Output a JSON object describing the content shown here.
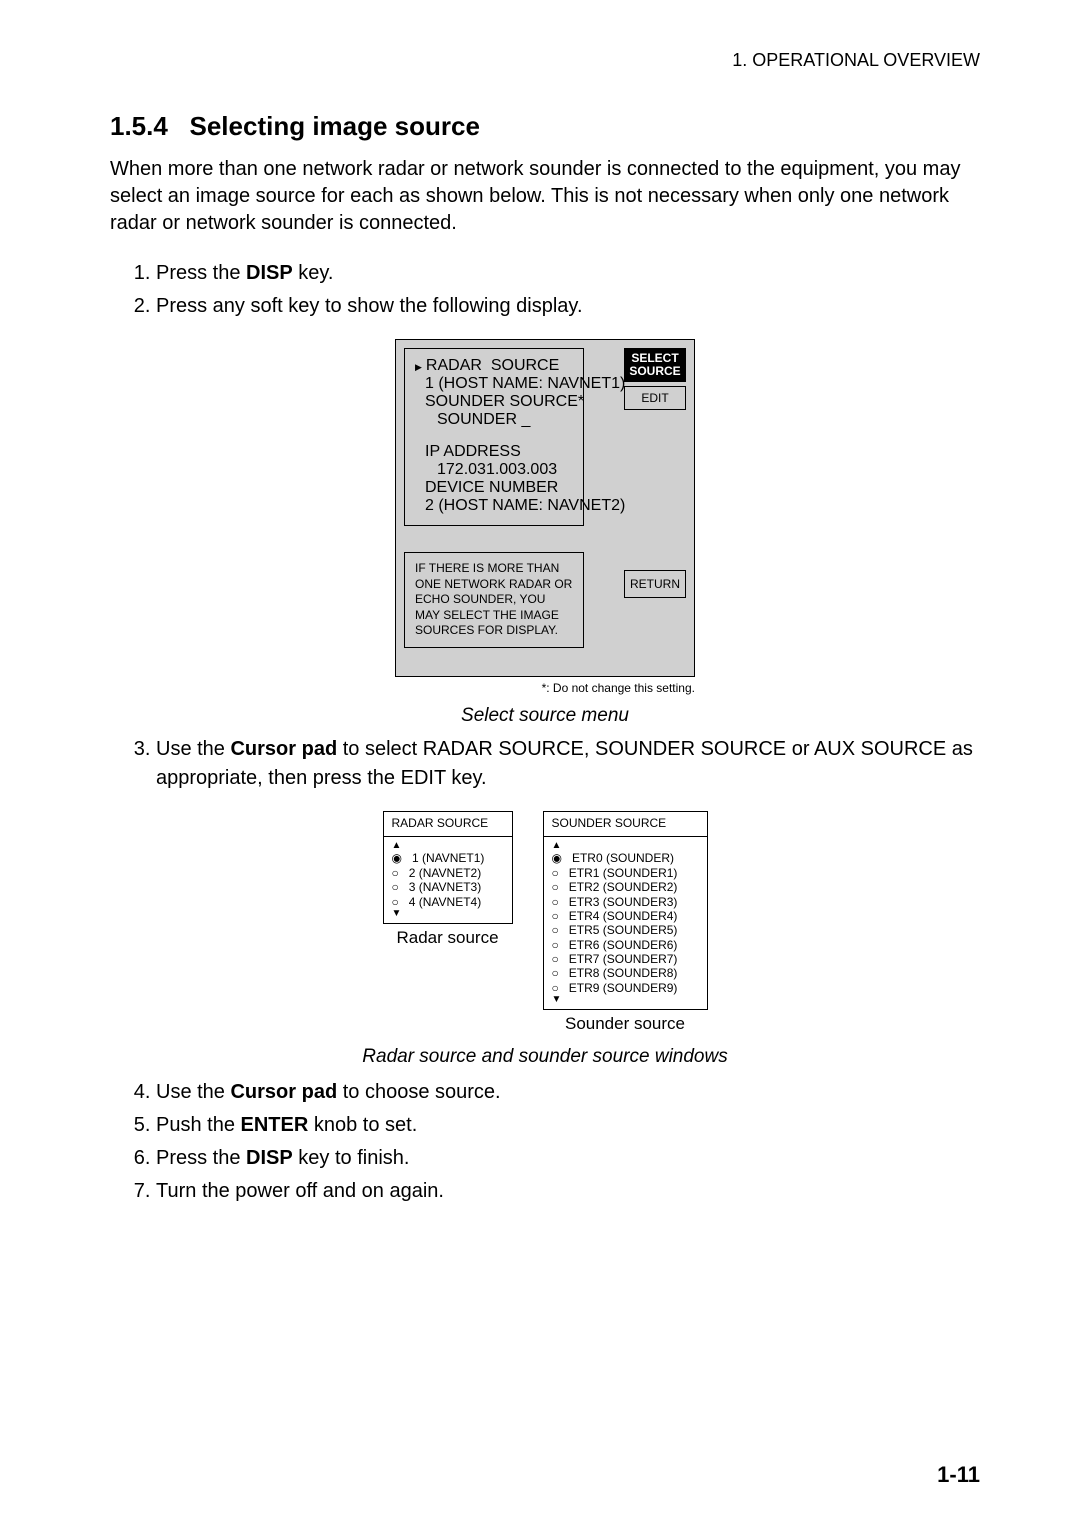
{
  "header": {
    "chapter": "1.  OPERATIONAL OVERVIEW"
  },
  "section": {
    "number": "1.5.4",
    "title": "Selecting image source",
    "intro": "When more than one network radar or network sounder is connected to the equipment, you may select an image source for each as shown below. This is not necessary when only one network radar or network sounder is connected."
  },
  "steps_a": [
    {
      "pre": "Press the ",
      "bold": "DISP",
      "post": " key."
    },
    {
      "pre": "Press any soft key to show the following display.",
      "bold": "",
      "post": ""
    }
  ],
  "fig1": {
    "box1": {
      "l1": "RADAR  SOURCE",
      "l2": "1 (HOST NAME: NAVNET1)",
      "l3": "SOUNDER SOURCE*",
      "l4": "SOUNDER _",
      "l5": "IP ADDRESS",
      "l6": "172.031.003.003",
      "l7": "DEVICE NUMBER",
      "l8": "2 (HOST NAME: NAVNET2)"
    },
    "box2": "IF THERE IS MORE THAN ONE NETWORK RADAR OR ECHO SOUNDER, YOU MAY SELECT THE IMAGE SOURCES FOR DISPLAY.",
    "btn_select_l1": "SELECT",
    "btn_select_l2": "SOURCE",
    "btn_edit": "EDIT",
    "btn_return": "RETURN",
    "note": "*: Do not change this setting.",
    "caption": "Select source menu"
  },
  "steps_b": [
    {
      "pre": "Use the ",
      "bold": "Cursor pad",
      "post": " to select RADAR SOURCE, SOUNDER SOURCE or AUX SOURCE as appropriate, then press the EDIT key."
    }
  ],
  "fig2": {
    "radar": {
      "title": "RADAR SOURCE",
      "items": [
        "1 (NAVNET1)",
        "2 (NAVNET2)",
        "3 (NAVNET3)",
        "4 (NAVNET4)"
      ],
      "selected": 0,
      "caption": "Radar source"
    },
    "sounder": {
      "title": "SOUNDER SOURCE",
      "items": [
        "ETR0 (SOUNDER)",
        "ETR1 (SOUNDER1)",
        "ETR2 (SOUNDER2)",
        "ETR3 (SOUNDER3)",
        "ETR4 (SOUNDER4)",
        "ETR5 (SOUNDER5)",
        "ETR6 (SOUNDER6)",
        "ETR7 (SOUNDER7)",
        "ETR8 (SOUNDER8)",
        "ETR9 (SOUNDER9)"
      ],
      "selected": 0,
      "caption": "Sounder source"
    },
    "caption": "Radar source and sounder source windows"
  },
  "steps_c": [
    {
      "pre": "Use the ",
      "bold": "Cursor pad",
      "post": " to choose source."
    },
    {
      "pre": "Push the ",
      "bold": "ENTER",
      "post": " knob to set."
    },
    {
      "pre": "Press the ",
      "bold": "DISP",
      "post": " key to finish."
    },
    {
      "pre": "Turn the power off and on again.",
      "bold": "",
      "post": ""
    }
  ],
  "page_number": "1-11"
}
